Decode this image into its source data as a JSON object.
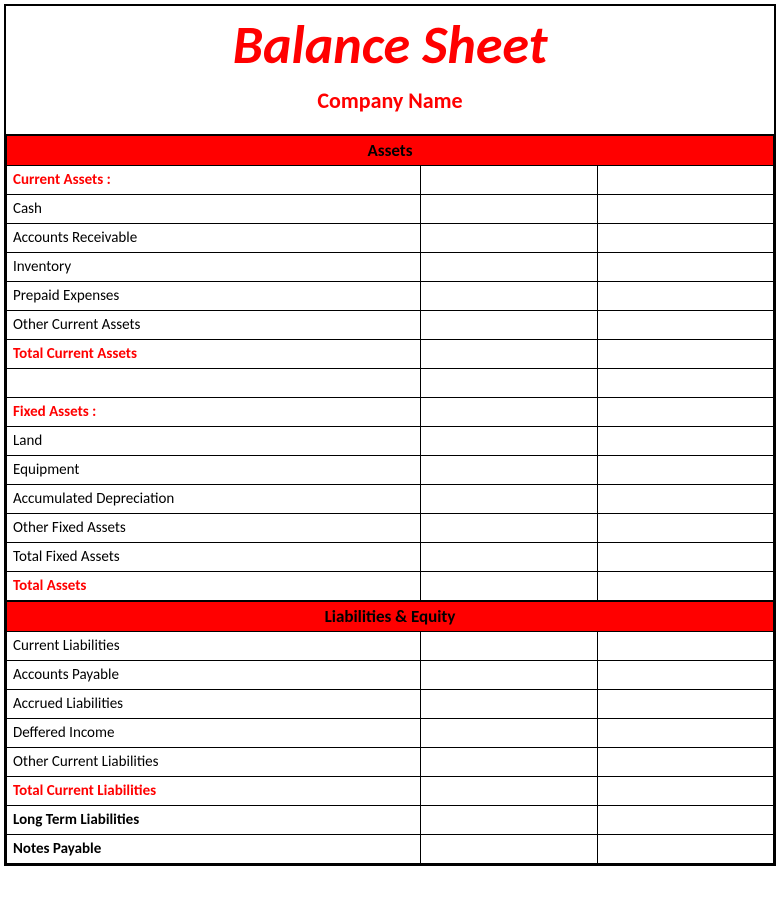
{
  "header": {
    "title": "Balance Sheet",
    "subtitle": "Company Name"
  },
  "sections": {
    "assets": {
      "heading": "Assets",
      "rows": [
        {
          "label": "Current Assets :",
          "style": "red-bold"
        },
        {
          "label": "Cash",
          "style": ""
        },
        {
          "label": "Accounts Receivable",
          "style": ""
        },
        {
          "label": "Inventory",
          "style": ""
        },
        {
          "label": "Prepaid Expenses",
          "style": ""
        },
        {
          "label": "Other Current Assets",
          "style": ""
        },
        {
          "label": "Total Current Assets",
          "style": "red-bold"
        },
        {
          "label": "",
          "style": ""
        },
        {
          "label": "Fixed Assets :",
          "style": "red-bold"
        },
        {
          "label": "Land",
          "style": ""
        },
        {
          "label": "Equipment",
          "style": ""
        },
        {
          "label": "Accumulated Depreciation",
          "style": ""
        },
        {
          "label": "Other Fixed Assets",
          "style": ""
        },
        {
          "label": "Total Fixed Assets",
          "style": ""
        },
        {
          "label": "Total Assets",
          "style": "red-bold"
        }
      ]
    },
    "liabilities": {
      "heading": "Liabilities & Equity",
      "rows": [
        {
          "label": "Current Liabilities",
          "style": ""
        },
        {
          "label": "Accounts Payable",
          "style": ""
        },
        {
          "label": "Accrued Liabilities",
          "style": ""
        },
        {
          "label": "Deffered Income",
          "style": ""
        },
        {
          "label": "Other Current Liabilities",
          "style": ""
        },
        {
          "label": "Total Current Liabilities",
          "style": "red-bold"
        },
        {
          "label": "Long Term Liabilities",
          "style": "black-bold"
        },
        {
          "label": "Notes Payable",
          "style": "black-bold"
        }
      ]
    }
  }
}
